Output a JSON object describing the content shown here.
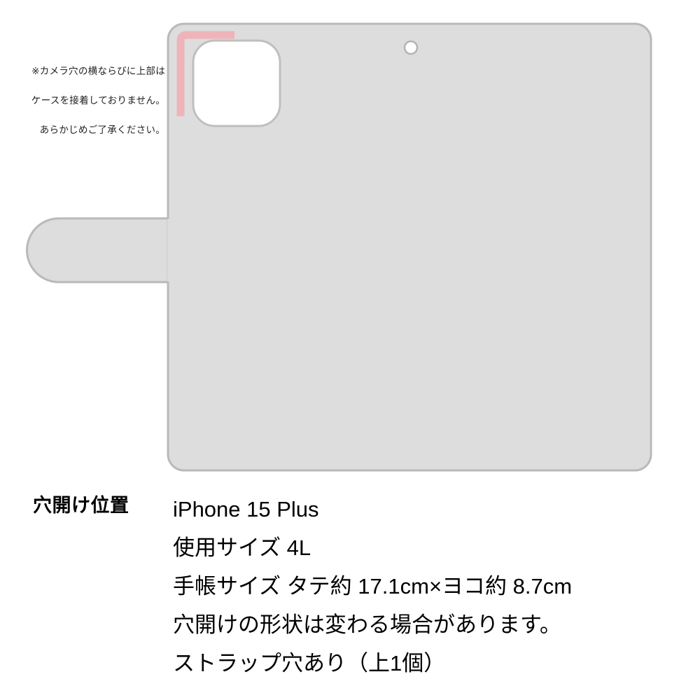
{
  "note": {
    "name": "camera-hole-note",
    "lines": [
      "※カメラ穴の横ならびに上部は",
      "ケースを接着しておりません。",
      "あらかじめご了承ください。"
    ]
  },
  "diagram": {
    "name": "phone-case-hole-diagram",
    "body_label": "case-body",
    "camera_cutout_label": "camera-cutout",
    "sensor_hole_label": "sensor-hole",
    "strap_tab_label": "strap-tab",
    "highlight_label": "non-adhered-edge-highlight",
    "colors": {
      "body_fill": "#dddddd",
      "body_stroke": "#b3b3b3",
      "cutout_fill": "#ffffff",
      "cutout_stroke": "#bfbfbf",
      "highlight": "#efb4b9",
      "page_background": "#ffffff"
    }
  },
  "spec": {
    "label": "穴開け位置",
    "lines": [
      "iPhone 15 Plus",
      "使用サイズ 4L",
      "手帳サイズ タテ約 17.1cm×ヨコ約 8.7cm",
      "穴開けの形状は変わる場合があります。",
      "ストラップ穴あり（上1個）"
    ],
    "device": "iPhone 15 Plus",
    "size_code": "4L",
    "notebook_height_cm": "17.1cm",
    "notebook_width_cm": "8.7cm",
    "strap_hole_count": "上1個"
  }
}
